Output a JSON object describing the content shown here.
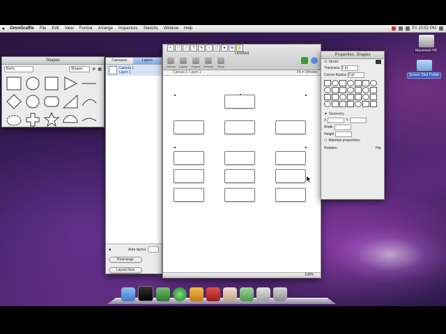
{
  "menubar": {
    "app_name": "OmniGraffle",
    "items": [
      "File",
      "Edit",
      "View",
      "Format",
      "Arrange",
      "Inspectors",
      "Stencils",
      "Window",
      "Help"
    ],
    "clock": "Fri 10:52 PM"
  },
  "palette": {
    "title": "Shapes",
    "style_select": "Basic",
    "filter_select": "Shapes"
  },
  "layers": {
    "tabs": [
      "Canvases",
      "Layers"
    ],
    "canvas_name": "Canvas 1",
    "canvas_sub": "Layer 1",
    "bottom_label": "Auto layout",
    "bottom_button1": "Rearrange",
    "bottom_button2": "Layout Now"
  },
  "document": {
    "title": "Untitled",
    "toolbar_buttons": [
      "Canvas",
      "Layers",
      "Inspect",
      "Stencils",
      "Zoom",
      "Share"
    ],
    "ruler_left": "Canvas 1: Layer 1",
    "ruler_right": "Fit in Window",
    "status": "100%"
  },
  "inspector": {
    "title": "Properties: Shapes",
    "label1": "Stroke",
    "thickness_label": "Thickness",
    "thickness_value": "1 pt",
    "corner_label": "Corner Radius",
    "corner_value": "0 pt",
    "geometry_label": "Geometry",
    "geo_fields": [
      "X",
      "Y",
      "Width",
      "Height"
    ],
    "maintain_label": "Maintain proportions",
    "angle_label": "Rotation",
    "flip_label": "Flip"
  },
  "desktop": {
    "hd_label": "Macintosh HD",
    "folder_label": "Screen Shot Folder"
  }
}
